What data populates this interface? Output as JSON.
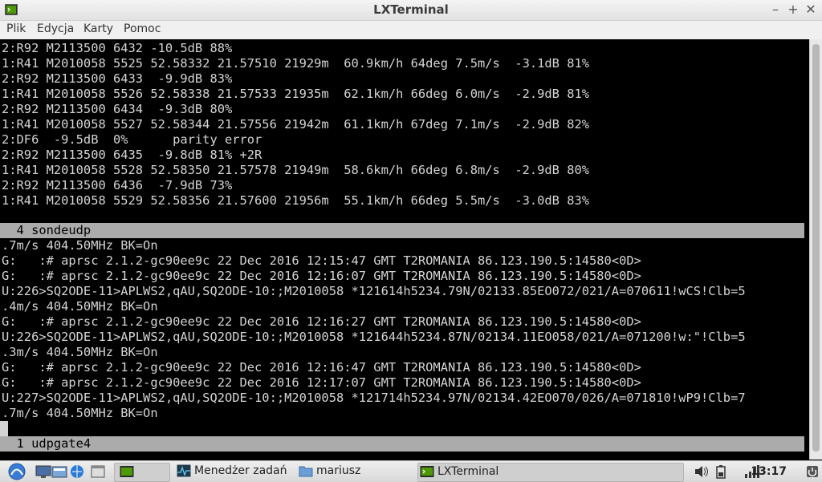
{
  "window": {
    "title": "LXTerminal",
    "controls": [
      "–",
      "+",
      "✕"
    ]
  },
  "menu": [
    "Plik",
    "Edycja",
    "Karty",
    "Pomoc"
  ],
  "terminal": {
    "lines_top": [
      "2:R92 M2113500 6432 -10.5dB 88%",
      "1:R41 M2010058 5525 52.58332 21.57510 21929m  60.9km/h 64deg 7.5m/s  -3.1dB 81%",
      "2:R92 M2113500 6433  -9.9dB 83%",
      "1:R41 M2010058 5526 52.58338 21.57533 21935m  62.1km/h 66deg 6.0m/s  -2.9dB 81%",
      "2:R92 M2113500 6434  -9.3dB 80%",
      "1:R41 M2010058 5527 52.58344 21.57556 21942m  61.1km/h 67deg 7.1m/s  -2.9dB 82%",
      "2:DF6  -9.5dB  0%      parity error",
      "2:R92 M2113500 6435  -9.8dB 81% +2R",
      "1:R41 M2010058 5528 52.58350 21.57578 21949m  58.6km/h 66deg 6.8m/s  -2.9dB 80%",
      "2:R92 M2113500 6436  -7.9dB 73%",
      "1:R41 M2010058 5529 52.58356 21.57600 21956m  55.1km/h 66deg 5.5m/s  -3.0dB 83%"
    ],
    "pane1_title": "  4 sondeudp",
    "lines_bottom": [
      ".7m/s 404.50MHz BK=On",
      "G:   :# aprsc 2.1.2-gc90ee9c 22 Dec 2016 12:15:47 GMT T2ROMANIA 86.123.190.5:14580<0D>",
      "G:   :# aprsc 2.1.2-gc90ee9c 22 Dec 2016 12:16:07 GMT T2ROMANIA 86.123.190.5:14580<0D>",
      "U:226>SQ2ODE-11>APLWS2,qAU,SQ2ODE-10:;M2010058 *121614h5234.79N/02133.85EO072/021/A=070611!wCS!Clb=5",
      ".4m/s 404.50MHz BK=On",
      "G:   :# aprsc 2.1.2-gc90ee9c 22 Dec 2016 12:16:27 GMT T2ROMANIA 86.123.190.5:14580<0D>",
      "U:226>SQ2ODE-11>APLWS2,qAU,SQ2ODE-10:;M2010058 *121644h5234.87N/02134.11EO058/021/A=071200!w:\"!Clb=5",
      ".3m/s 404.50MHz BK=On",
      "G:   :# aprsc 2.1.2-gc90ee9c 22 Dec 2016 12:16:47 GMT T2ROMANIA 86.123.190.5:14580<0D>",
      "G:   :# aprsc 2.1.2-gc90ee9c 22 Dec 2016 12:17:07 GMT T2ROMANIA 86.123.190.5:14580<0D>",
      "U:227>SQ2ODE-11>APLWS2,qAU,SQ2ODE-10:;M2010058 *121714h5234.97N/02134.42EO070/026/A=071810!wP9!Clb=7",
      ".7m/s 404.50MHz BK=On"
    ],
    "pane2_title": "  1 udpgate4"
  },
  "taskbar": {
    "tasks": [
      {
        "label": "Menedżer zadań",
        "icon": "task-manager-icon"
      },
      {
        "label": "mariusz",
        "icon": "folder-icon"
      },
      {
        "label": "LXTerminal",
        "icon": "terminal-icon"
      }
    ],
    "clock": "13:17"
  }
}
